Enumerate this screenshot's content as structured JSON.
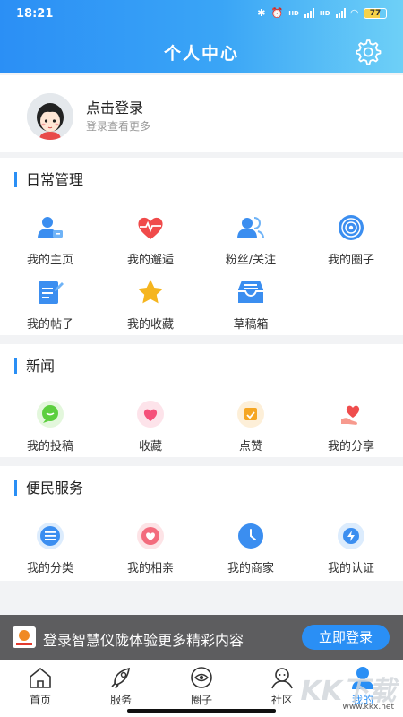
{
  "status_bar": {
    "time": "18:21",
    "battery": "77",
    "hd1": "HD",
    "hd2": "HD"
  },
  "header": {
    "title": "个人中心",
    "settings_icon": "gear-icon"
  },
  "login": {
    "title": "点击登录",
    "subtitle": "登录查看更多"
  },
  "sections": {
    "daily": {
      "title": "日常管理",
      "items": [
        {
          "label": "我的主页",
          "icon": "user-card-icon"
        },
        {
          "label": "我的邂逅",
          "icon": "heart-pulse-icon"
        },
        {
          "label": "粉丝/关注",
          "icon": "fans-icon"
        },
        {
          "label": "我的圈子",
          "icon": "circle-icon"
        },
        {
          "label": "我的帖子",
          "icon": "post-edit-icon"
        },
        {
          "label": "我的收藏",
          "icon": "star-icon"
        },
        {
          "label": "草稿箱",
          "icon": "drafts-tray-icon"
        }
      ]
    },
    "news": {
      "title": "新闻",
      "items": [
        {
          "label": "我的投稿",
          "icon": "chat-bubble-icon"
        },
        {
          "label": "收藏",
          "icon": "heart-badge-icon"
        },
        {
          "label": "点赞",
          "icon": "like-box-icon"
        },
        {
          "label": "我的分享",
          "icon": "hand-heart-icon"
        }
      ]
    },
    "service": {
      "title": "便民服务",
      "items": [
        {
          "label": "我的分类",
          "icon": "list-icon"
        },
        {
          "label": "我的相亲",
          "icon": "couple-icon"
        },
        {
          "label": "我的商家",
          "icon": "clock-icon"
        },
        {
          "label": "我的认证",
          "icon": "verified-icon"
        }
      ]
    }
  },
  "banner": {
    "text": "登录智慧仪陇体验更多精彩内容",
    "button": "立即登录"
  },
  "tabbar": [
    {
      "label": "首页",
      "icon": "home-icon"
    },
    {
      "label": "服务",
      "icon": "rocket-icon"
    },
    {
      "label": "圈子",
      "icon": "eye-circle-icon"
    },
    {
      "label": "社区",
      "icon": "community-icon"
    },
    {
      "label": "我的",
      "icon": "profile-icon"
    }
  ],
  "watermark": {
    "text": "KK下载",
    "url": "www.kkx.net"
  },
  "colors": {
    "accent": "#2a8ff5",
    "header_start": "#2b8ff5",
    "header_end": "#6ed0f7",
    "banner_bg": "#5d5d5f"
  }
}
